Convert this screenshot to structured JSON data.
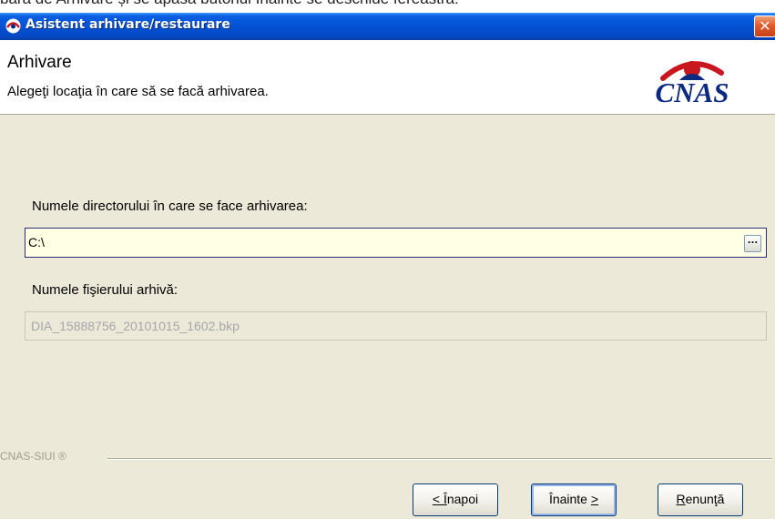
{
  "document": {
    "clipped_line": "bară de Arhivare și se apasă butonul Înainte se deschide fereastra:"
  },
  "window": {
    "title": "Asistent arhivare/restaurare",
    "close_glyph": "✕"
  },
  "header": {
    "title": "Arhivare",
    "subtitle": "Alegeţi locaţia în care să se facă arhivarea.",
    "logo_text": "CNAS",
    "logo_color": "#0b2a80",
    "logo_arc_color": "#c8171e"
  },
  "form": {
    "directory_label": "Numele directorului în care se face arhivarea:",
    "directory_value": "C:\\",
    "browse_label": "...",
    "file_label": "Numele fişierului arhivă:",
    "file_value": "DIA_15888756_20101015_1602.bkp"
  },
  "footer": {
    "brand": "CNAS-SIUI ®"
  },
  "buttons": {
    "back_mnemonic": "Î",
    "back_rest": "napoi",
    "back_prefix": "< ",
    "next_label": "Înainte ",
    "next_mnemonic": ">",
    "cancel_mnemonic": "R",
    "cancel_rest": "enunţă"
  },
  "colors": {
    "titlebar": "#0555d8",
    "dialog_bg": "#ECE9D8",
    "input_bg": "#ffffe4",
    "close_button": "#e25a2a"
  }
}
